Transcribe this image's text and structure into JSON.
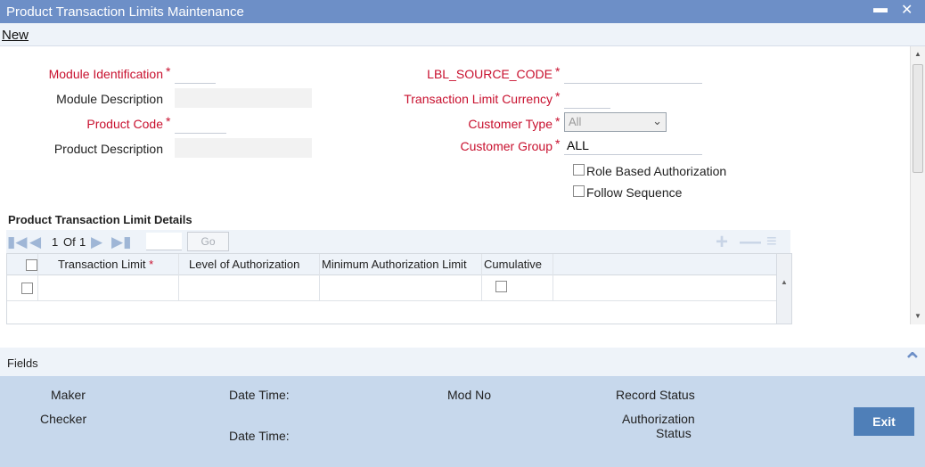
{
  "window": {
    "title": "Product Transaction Limits Maintenance",
    "minimize_glyph": "▬",
    "close_glyph": "✕"
  },
  "menu": {
    "new_label": "New"
  },
  "form": {
    "module_identification": {
      "label": "Module Identification",
      "value": ""
    },
    "module_description": {
      "label": "Module Description",
      "value": ""
    },
    "product_code": {
      "label": "Product Code",
      "value": ""
    },
    "product_description": {
      "label": "Product Description",
      "value": ""
    },
    "source_code": {
      "label": "LBL_SOURCE_CODE",
      "value": ""
    },
    "transaction_limit_currency": {
      "label": "Transaction Limit Currency",
      "value": ""
    },
    "customer_type": {
      "label": "Customer Type",
      "value": "All"
    },
    "customer_group": {
      "label": "Customer Group",
      "value": "ALL"
    },
    "role_based_authorization": {
      "label": "Role Based Authorization",
      "checked": false
    },
    "follow_sequence": {
      "label": "Follow Sequence",
      "checked": false
    },
    "required_mark": "*"
  },
  "details": {
    "title": "Product Transaction Limit Details",
    "pager": {
      "current": "1",
      "of_label": "Of",
      "total": "1",
      "go_label": "Go"
    },
    "columns": [
      "Transaction Limit",
      "Level of Authorization",
      "Minimum Authorization Limit",
      "Cumulative"
    ],
    "required_mark": "*",
    "rows": [
      {
        "transaction_limit": "",
        "level_of_authorization": "",
        "minimum_authorization_limit": "",
        "cumulative": false
      }
    ]
  },
  "fields_bar": {
    "label": "Fields"
  },
  "footer": {
    "maker": "Maker",
    "checker": "Checker",
    "date_time_1": "Date Time:",
    "date_time_2": "Date Time:",
    "mod_no": "Mod No",
    "record_status": "Record Status",
    "authorization_status_line1": "Authorization",
    "authorization_status_line2": "Status",
    "exit_label": "Exit"
  },
  "colors": {
    "title_bar": "#6d8fc7",
    "required_label": "#c8102e",
    "footer_bg": "#c7d8ec",
    "exit_button": "#4f7fb8"
  }
}
